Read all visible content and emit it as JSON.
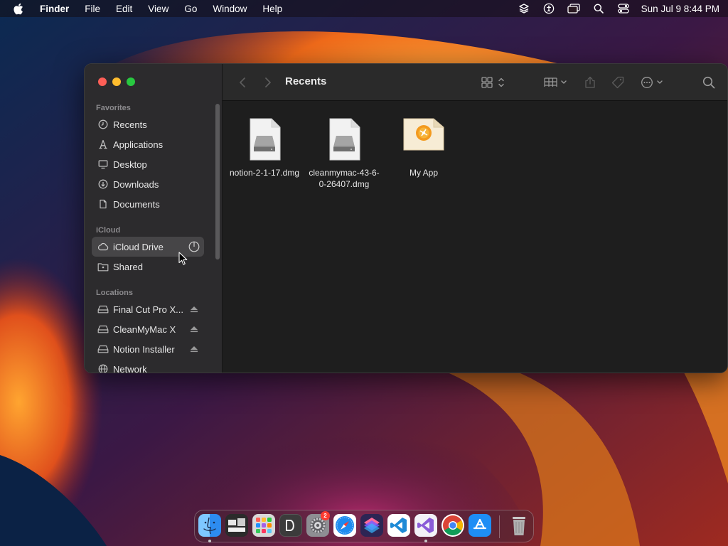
{
  "menubar": {
    "app_name": "Finder",
    "menus": [
      "File",
      "Edit",
      "View",
      "Go",
      "Window",
      "Help"
    ],
    "clock": "Sun Jul 9  8:44 PM",
    "status_icons": [
      "dropbox-icon",
      "accessibility-icon",
      "screen-mirroring-icon",
      "spotlight-search-icon",
      "control-center-icon"
    ]
  },
  "window": {
    "title": "Recents",
    "sidebar": {
      "favorites_header": "Favorites",
      "favorites": [
        {
          "label": "Recents",
          "icon": "clock-icon"
        },
        {
          "label": "Applications",
          "icon": "applications-icon"
        },
        {
          "label": "Desktop",
          "icon": "desktop-icon"
        },
        {
          "label": "Downloads",
          "icon": "download-icon"
        },
        {
          "label": "Documents",
          "icon": "document-icon"
        }
      ],
      "icloud_header": "iCloud",
      "icloud": [
        {
          "label": "iCloud Drive",
          "icon": "cloud-icon",
          "selected": true,
          "trailing_icon": "progress-icon"
        },
        {
          "label": "Shared",
          "icon": "shared-folder-icon"
        }
      ],
      "locations_header": "Locations",
      "locations": [
        {
          "label": "Final Cut Pro X...",
          "icon": "disk-icon",
          "trailing_icon": "eject-icon"
        },
        {
          "label": "CleanMyMac X",
          "icon": "disk-icon",
          "trailing_icon": "eject-icon"
        },
        {
          "label": "Notion Installer",
          "icon": "disk-icon",
          "trailing_icon": "eject-icon"
        },
        {
          "label": "Network",
          "icon": "globe-icon"
        }
      ]
    },
    "files": [
      {
        "name": "notion-2-1-17.dmg",
        "icon": "disk-image-icon"
      },
      {
        "name": "cleanmymac-43-6-0-26407.dmg",
        "icon": "disk-image-icon"
      },
      {
        "name": "My App",
        "icon": "app-document-icon"
      }
    ]
  },
  "dock": {
    "apps": [
      {
        "name": "finder-icon",
        "color": "#2d8cf0",
        "running": true
      },
      {
        "name": "terminal-desktop-icon",
        "color": "#2b2b2b",
        "running": false
      },
      {
        "name": "launchpad-icon",
        "color": "#d9d9d9",
        "running": false
      },
      {
        "name": "dictionary-icon",
        "color": "#3b3b3b",
        "running": false
      },
      {
        "name": "system-settings-icon",
        "color": "#8e8e93",
        "running": false,
        "badge": "2"
      },
      {
        "name": "safari-icon",
        "color": "#1d8bf0",
        "running": false
      },
      {
        "name": "shortcuts-icon",
        "color": "#5b3fd9",
        "running": false
      },
      {
        "name": "vscode-icon",
        "color": "#ffffff",
        "running": false
      },
      {
        "name": "visual-studio-icon",
        "color": "#f2f2f7",
        "running": true
      },
      {
        "name": "chrome-icon",
        "color": "#ffffff",
        "running": false
      },
      {
        "name": "app-store-icon",
        "color": "#1e8ef5",
        "running": false
      },
      {
        "name": "trash-icon",
        "color": "#9a9a9a",
        "running": false
      }
    ]
  }
}
